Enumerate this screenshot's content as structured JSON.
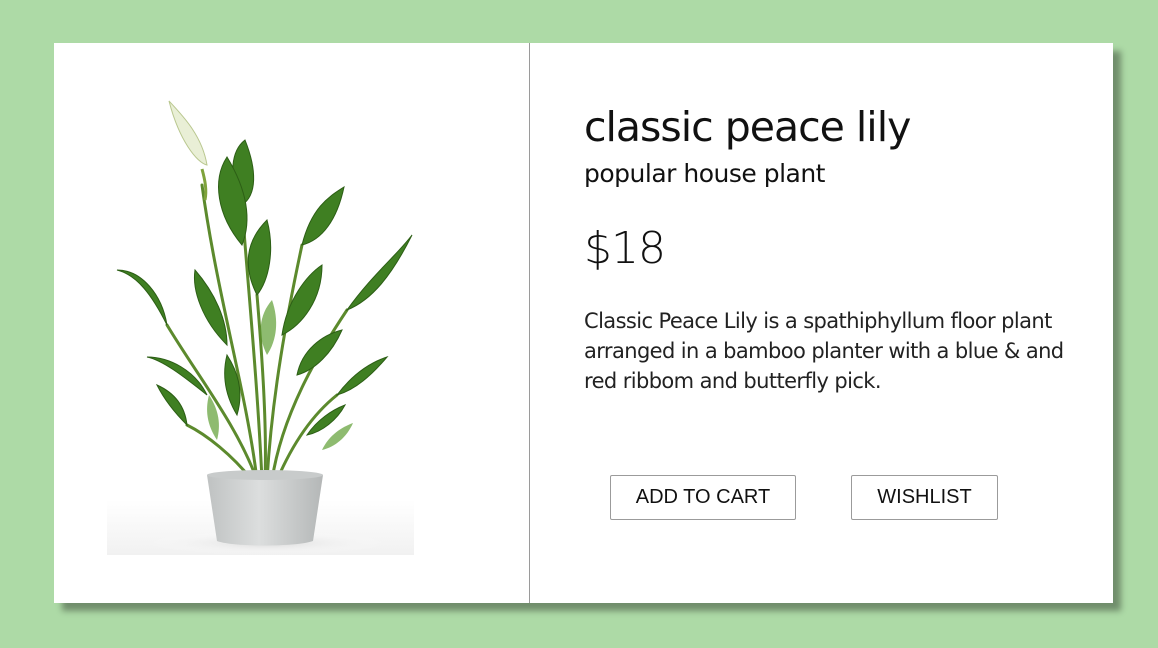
{
  "product": {
    "name": "classic peace lily",
    "tagline": "popular house plant",
    "price": "$18",
    "description": "Classic Peace Lily is a spathiphyllum floor plant arranged in a bamboo planter with a blue & and red ribbom and butterfly pick.",
    "image": {
      "leaf_color": "#3f7f22",
      "pot_color": "#d4d6d6"
    }
  },
  "actions": {
    "add_to_cart_label": "ADD TO CART",
    "wishlist_label": "WISHLIST"
  },
  "colors": {
    "page_background": "#addaa6",
    "card_background": "#ffffff",
    "divider": "#9a9a9a"
  }
}
